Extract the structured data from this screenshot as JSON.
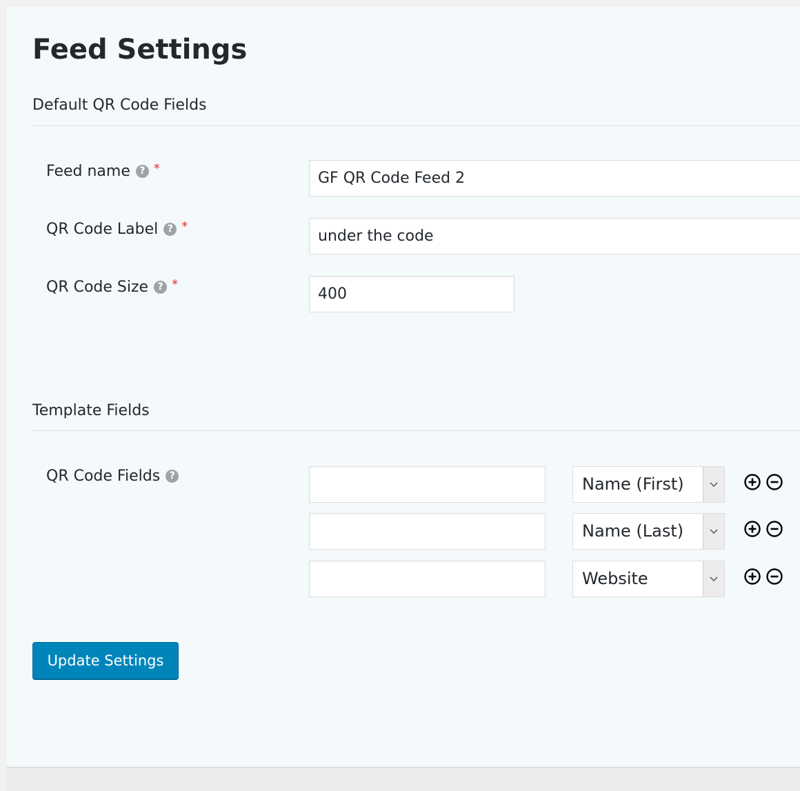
{
  "page": {
    "title": "Feed Settings"
  },
  "default_section": {
    "title": "Default QR Code Fields",
    "fields": [
      {
        "label": "Feed name",
        "help": "?",
        "required": "*",
        "value": "GF QR Code Feed 2"
      },
      {
        "label": "QR Code Label",
        "help": "?",
        "required": "*",
        "value": "under the code"
      },
      {
        "label": "QR Code Size",
        "help": "?",
        "required": "*",
        "value": "400"
      }
    ]
  },
  "template_section": {
    "title": "Template Fields",
    "field_label": "QR Code Fields",
    "help": "?",
    "rows": [
      {
        "key": "",
        "selected": "Name (First)",
        "add_icon": "plus-circle-icon",
        "remove_icon": "minus-circle-icon"
      },
      {
        "key": "",
        "selected": "Name (Last)",
        "add_icon": "plus-circle-icon",
        "remove_icon": "minus-circle-icon"
      },
      {
        "key": "",
        "selected": "Website",
        "add_icon": "plus-circle-icon",
        "remove_icon": "minus-circle-icon"
      }
    ]
  },
  "actions": {
    "update_label": "Update Settings"
  },
  "colors": {
    "panel_bg": "#f4f9fc",
    "button": "#0085ba",
    "required": "#d63638"
  }
}
